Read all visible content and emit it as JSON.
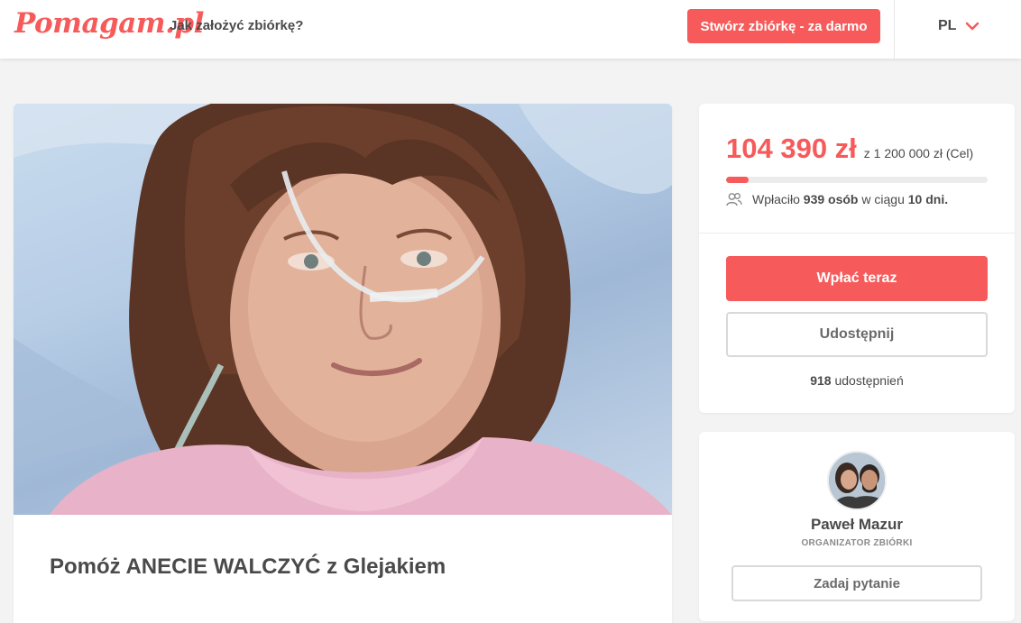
{
  "header": {
    "logo": "Pomagam.pl",
    "how_to_link": "Jak założyć zbiórkę?",
    "create_button": "Stwórz zbiórkę - za darmo",
    "language": "PL"
  },
  "campaign": {
    "title": "Pomóż ANECIE WALCZYĆ z Glejakiem"
  },
  "donation": {
    "amount": "104 390 zł",
    "goal": "z 1 200 000 zł (Cel)",
    "progress_fraction": 0.087,
    "donors_prefix": "Wpłaciło",
    "donors_count": "939 osób",
    "donors_middle": "w ciągu",
    "days": "10 dni.",
    "pay_button": "Wpłać teraz",
    "share_button": "Udostępnij",
    "shares_count": "918",
    "shares_label": "udostępnień"
  },
  "organizer": {
    "name": "Paweł Mazur",
    "role": "ORGANIZATOR ZBIÓRKI",
    "ask_button": "Zadaj pytanie"
  },
  "colors": {
    "accent": "#f65a5a",
    "background": "#f3f3f3",
    "text": "#4a4a4a"
  }
}
